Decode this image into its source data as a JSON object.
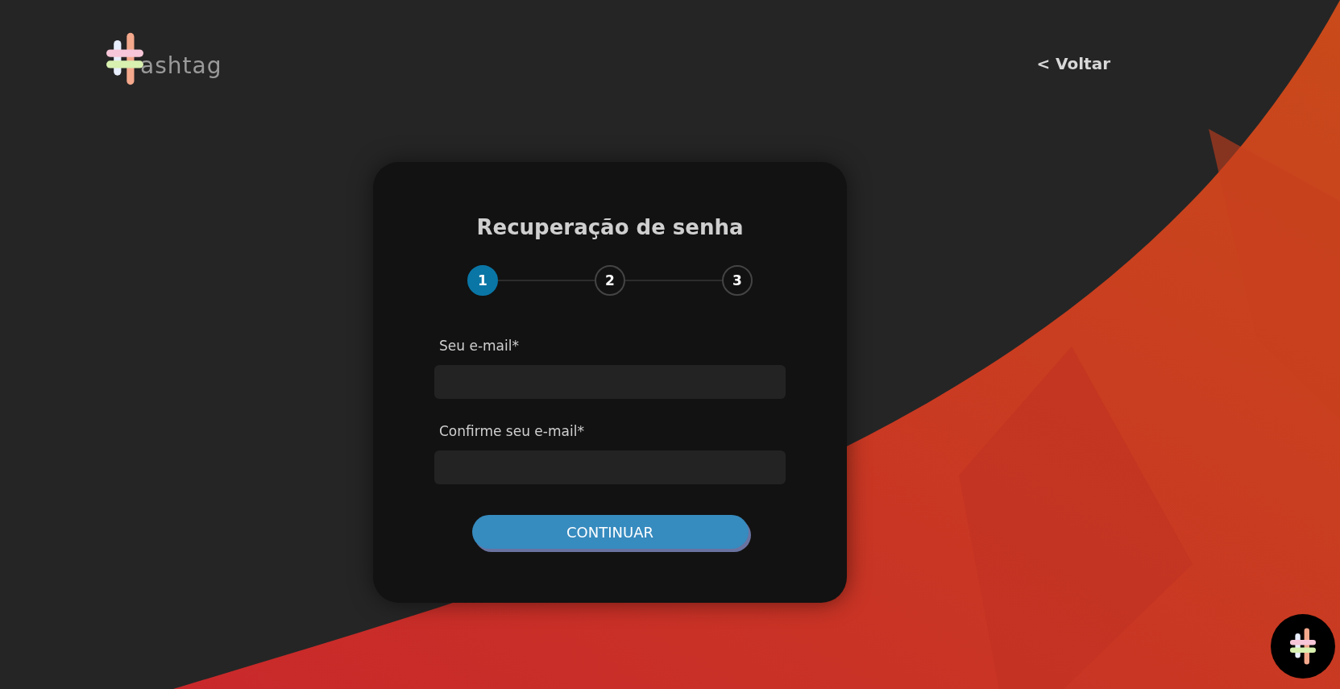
{
  "header": {
    "logo_text": "ashtag",
    "back_link": "< Voltar"
  },
  "card": {
    "title": "Recuperação de senha",
    "steps": [
      {
        "label": "1",
        "selected": true
      },
      {
        "label": "2",
        "selected": false
      },
      {
        "label": "3",
        "selected": false
      }
    ],
    "fields": [
      {
        "label": "Seu e-mail*"
      },
      {
        "label": "Confirme seu e-mail*"
      }
    ],
    "button": "CONTINUAR"
  }
}
